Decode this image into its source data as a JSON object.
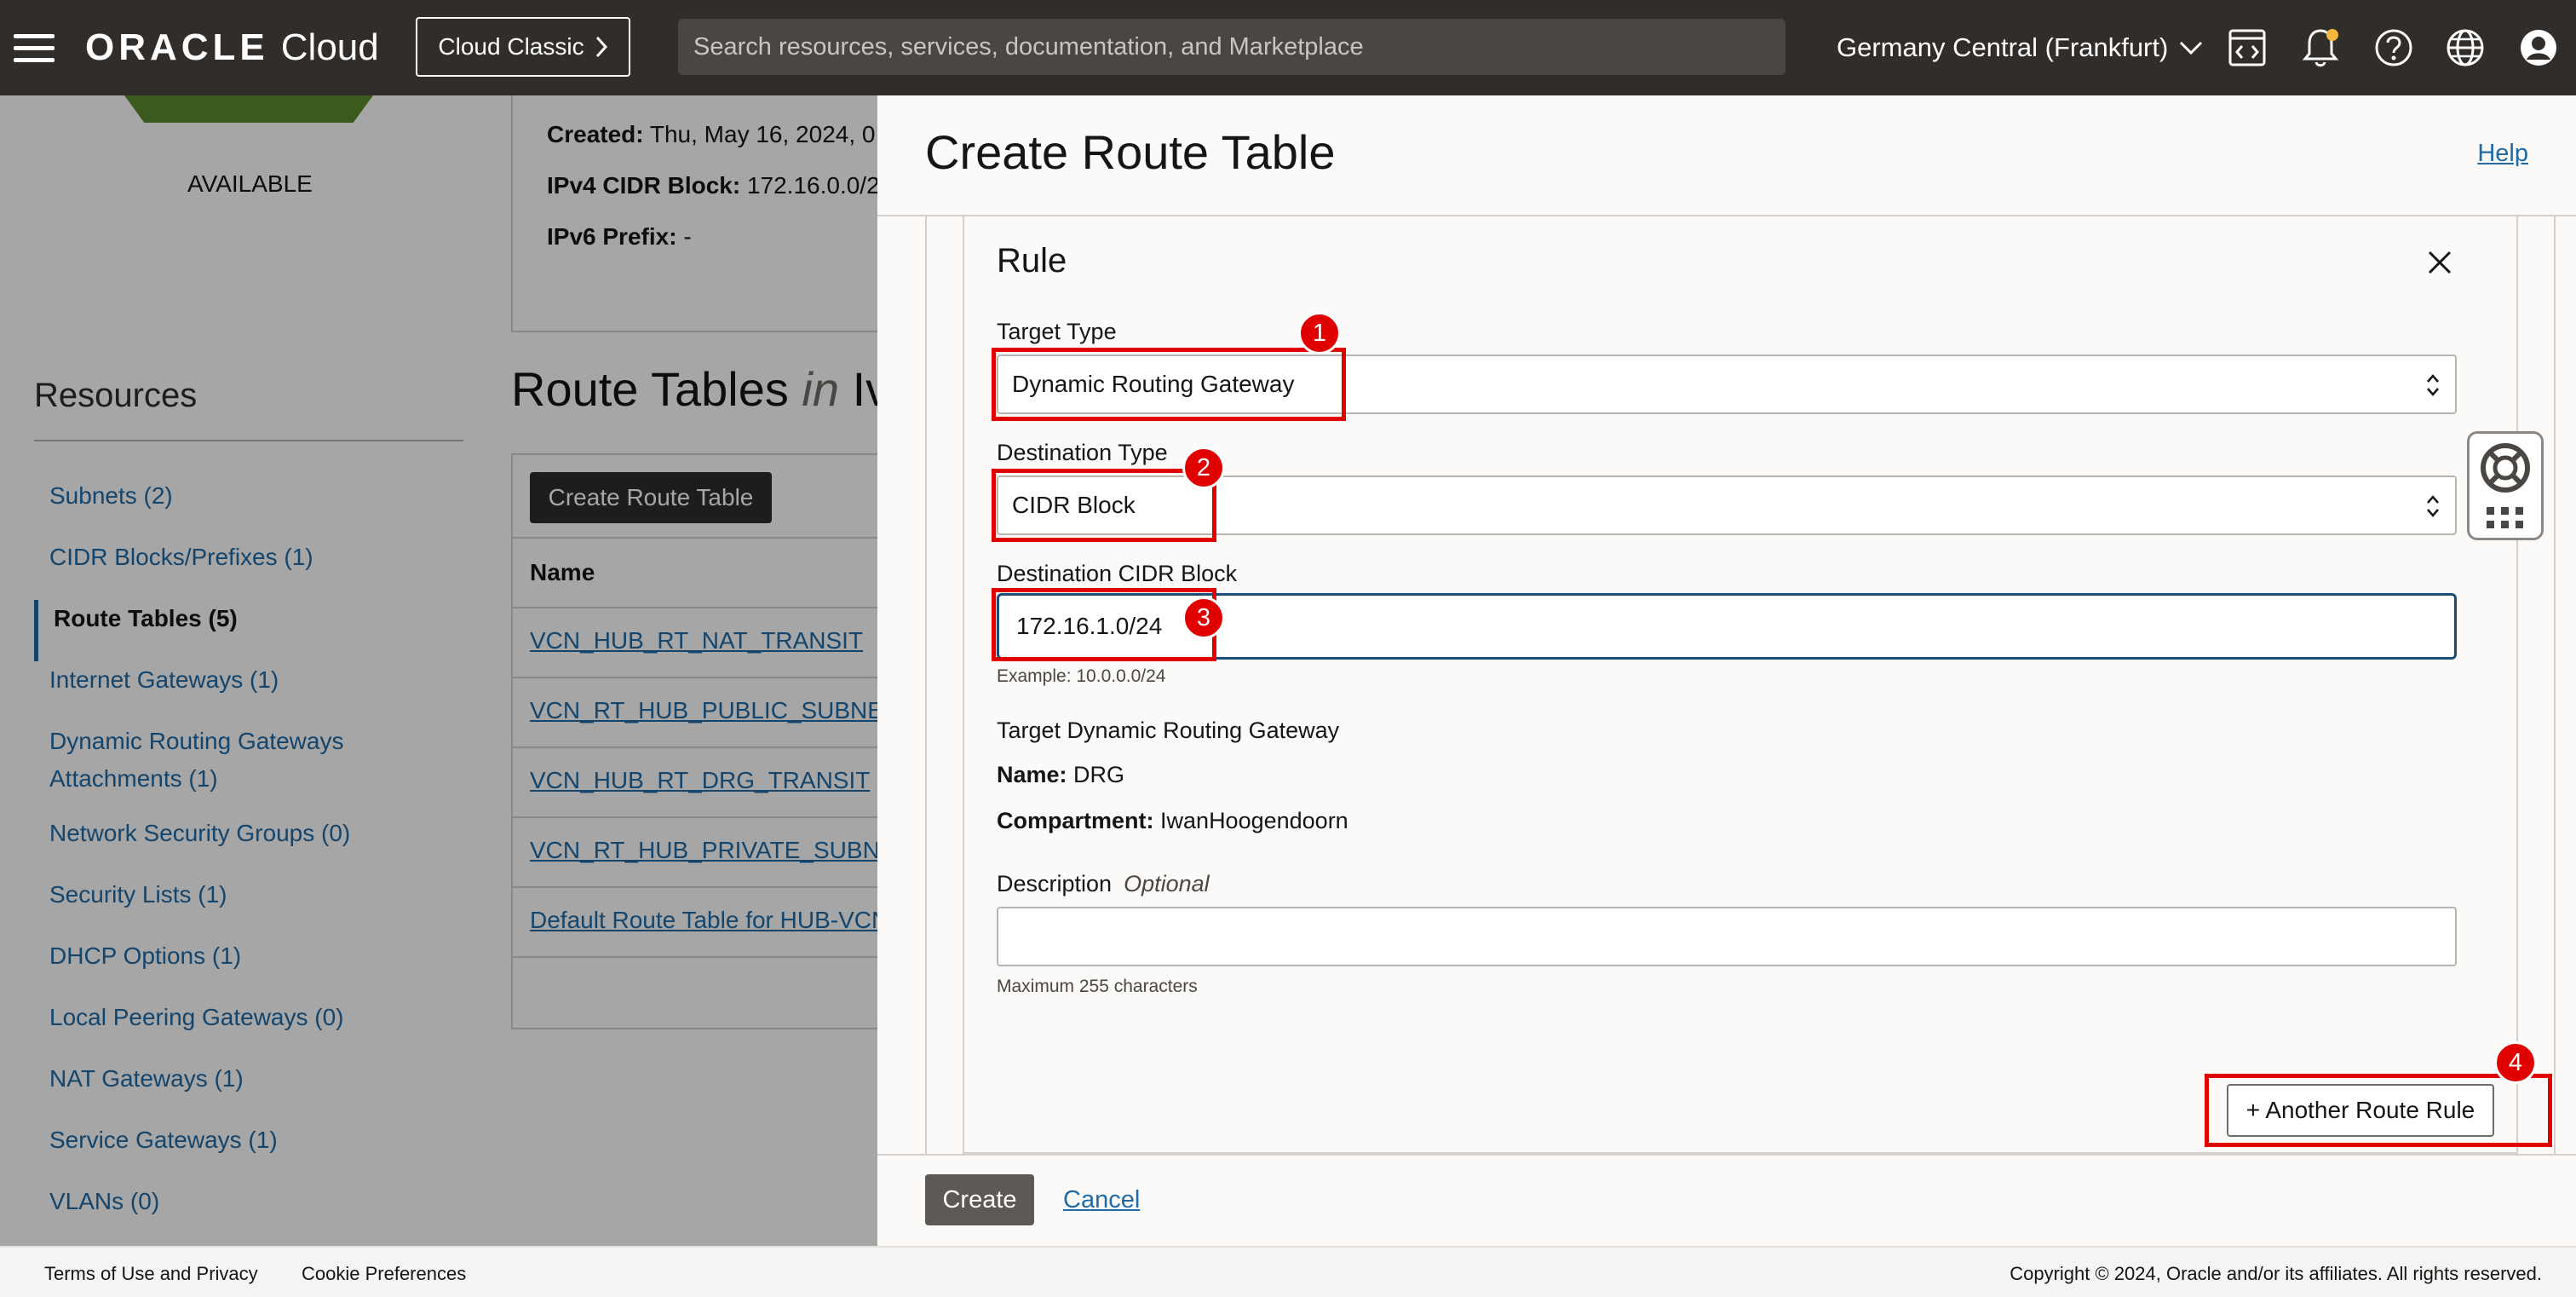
{
  "topbar": {
    "logo_word": "ORACLE",
    "logo_cloud": "Cloud",
    "classic_button": "Cloud Classic",
    "search_placeholder": "Search resources, services, documentation, and Marketplace",
    "region": "Germany Central (Frankfurt)",
    "icons": [
      "menu-icon",
      "code-editor-icon",
      "bell-icon",
      "help-icon",
      "globe-icon",
      "profile-icon"
    ]
  },
  "vcn": {
    "status": "AVAILABLE",
    "created_label": "Created:",
    "created_value": "Thu, May 16, 2024, 0",
    "ipv4_label": "IPv4 CIDR Block:",
    "ipv4_value": "172.16.0.0/2",
    "ipv6_label": "IPv6 Prefix:",
    "ipv6_value": "-"
  },
  "resources": {
    "title": "Resources",
    "items": [
      {
        "label": "Subnets (2)"
      },
      {
        "label": "CIDR Blocks/Prefixes (1)"
      },
      {
        "label": "Route Tables (5)"
      },
      {
        "label": "Internet Gateways (1)"
      },
      {
        "label": "Dynamic Routing Gateways Attachments (1)"
      },
      {
        "label": "Network Security Groups (0)"
      },
      {
        "label": "Security Lists (1)"
      },
      {
        "label": "DHCP Options (1)"
      },
      {
        "label": "Local Peering Gateways (0)"
      },
      {
        "label": "NAT Gateways (1)"
      },
      {
        "label": "Service Gateways (1)"
      },
      {
        "label": "VLANs (0)"
      }
    ]
  },
  "route_tables": {
    "heading_main": "Route Tables",
    "heading_in": "in",
    "heading_rest": "Iv",
    "create_button": "Create Route Table",
    "column_name": "Name",
    "rows": [
      "VCN_HUB_RT_NAT_TRANSIT",
      "VCN_RT_HUB_PUBLIC_SUBNET",
      "VCN_HUB_RT_DRG_TRANSIT",
      "VCN_RT_HUB_PRIVATE_SUBNET",
      "Default Route Table for HUB-VCN"
    ]
  },
  "panel": {
    "title": "Create Route Table",
    "help": "Help",
    "rule_title": "Rule",
    "target_type_label": "Target Type",
    "target_type_value": "Dynamic Routing Gateway",
    "destination_type_label": "Destination Type",
    "destination_type_value": "CIDR Block",
    "destination_cidr_label": "Destination CIDR Block",
    "destination_cidr_value": "172.16.1.0/24",
    "destination_cidr_hint": "Example: 10.0.0.0/24",
    "target_drg_label": "Target Dynamic Routing Gateway",
    "name_label": "Name:",
    "name_value": "DRG",
    "compartment_label": "Compartment:",
    "compartment_value": "IwanHoogendoorn",
    "description_label": "Description",
    "description_optional": "Optional",
    "description_hint": "Maximum 255 characters",
    "another_rule_button": "+ Another Route Rule",
    "create_button": "Create",
    "cancel_link": "Cancel"
  },
  "annotations": {
    "badge_1": "1",
    "badge_2": "2",
    "badge_3": "3",
    "badge_4": "4",
    "highlight_color": "#e00000"
  },
  "footer": {
    "terms": "Terms of Use and Privacy",
    "cookies": "Cookie Preferences",
    "copyright": "Copyright © 2024, Oracle and/or its affiliates. All rights reserved."
  }
}
